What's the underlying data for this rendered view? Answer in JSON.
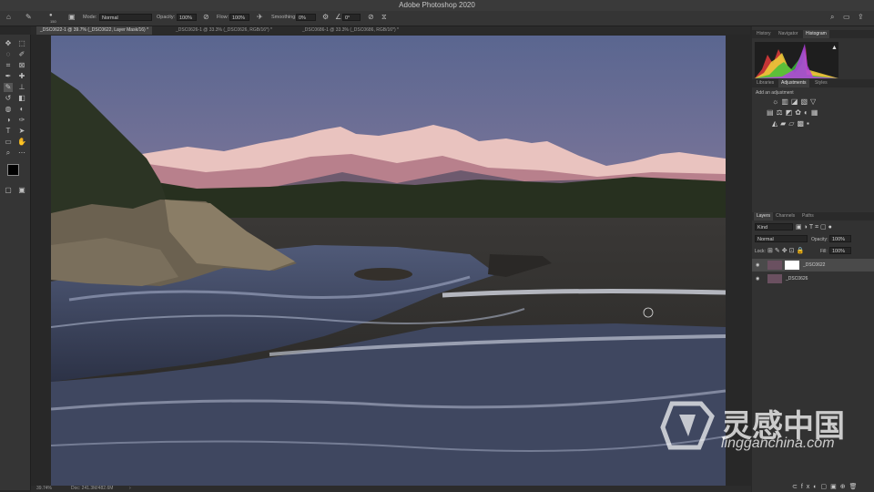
{
  "app": {
    "title": "Adobe Photoshop 2020"
  },
  "options": {
    "brush_size": "150",
    "mode_label": "Mode:",
    "mode_value": "Normal",
    "opacity_label": "Opacity:",
    "opacity_value": "100%",
    "flow_label": "Flow:",
    "flow_value": "100%",
    "smoothing_label": "Smoothing:",
    "smoothing_value": "0%",
    "angle_value": "0°"
  },
  "tabs": [
    {
      "label": "_DSC0622-1 @ 39.7% (_DSC0622, Layer Mask/16) *"
    },
    {
      "label": "_DSC0626-1 @ 33.3% (_DSC0626, RGB/16*) *"
    },
    {
      "label": "_DSC0686-1 @ 33.3% (_DSC0686, RGB/16*) *"
    }
  ],
  "status": {
    "zoom": "39.74%",
    "doc": "Doc: 241.3M/482.6M"
  },
  "panels": {
    "top_tabs": [
      "History",
      "Navigator",
      "Histogram"
    ],
    "mid_tabs": [
      "Libraries",
      "Adjustments",
      "Styles"
    ],
    "add_adjustment": "Add an adjustment",
    "layer_tabs": [
      "Layers",
      "Channels",
      "Paths"
    ],
    "kind_label": "Kind",
    "blend_mode": "Normal",
    "opacity_label": "Opacity:",
    "opacity_value": "100%",
    "lock_label": "Lock:",
    "fill_label": "Fill:",
    "fill_value": "100%",
    "layers": [
      {
        "name": "_DSC0622"
      },
      {
        "name": "_DSC0626"
      }
    ]
  },
  "watermark": {
    "cn": "灵感中国",
    "url": "lingganchina.com"
  },
  "colors": {
    "accent": "#4a4a4a",
    "panel": "#323232",
    "background": "#282828"
  }
}
